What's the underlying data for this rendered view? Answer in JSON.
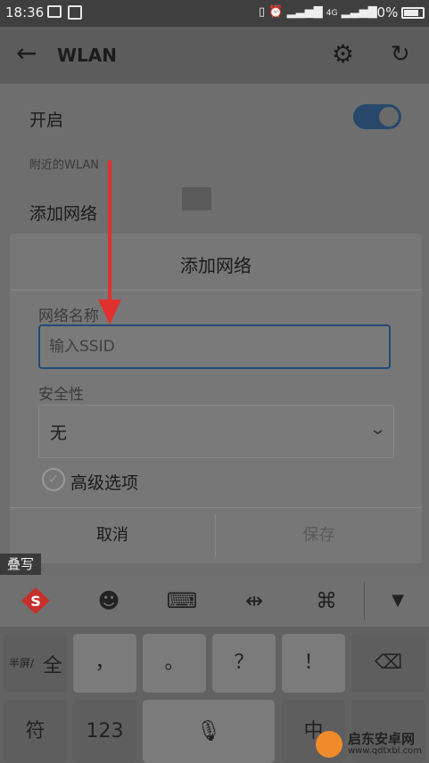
{
  "status_bar": {
    "time": "18:36",
    "network_left": "4G",
    "network_right": "4G\n2G",
    "battery": "80%"
  },
  "app_bar": {
    "title": "WLAN",
    "back_icon": "arrow-left-icon",
    "settings_icon": "gear-icon",
    "refresh_icon": "refresh-icon"
  },
  "settings": {
    "enable_label": "开启",
    "enable_state": true,
    "nearby_header": "附近的WLAN",
    "add_network_label": "添加网络"
  },
  "dialog": {
    "title": "添加网络",
    "ssid_label": "网络名称",
    "ssid_placeholder": "输入SSID",
    "ssid_value": "",
    "security_label": "安全性",
    "security_value": "无",
    "advanced_label": "高级选项",
    "cancel_label": "取消",
    "save_label": "保存"
  },
  "overlay_badge": "叠写",
  "keyboard": {
    "toolbar_icons": [
      "sogou-logo-icon",
      "emoji-icon",
      "keyboard-icon",
      "cursor-icon",
      "command-icon",
      "collapse-icon"
    ],
    "row1": {
      "halfwidth_label": "半屏/",
      "full_label": "全",
      "comma": "，",
      "period": "。",
      "question": "？",
      "exclaim": "！",
      "backspace_icon": "backspace-icon"
    },
    "row2": {
      "symbol_label": "符",
      "numbers_label": "123",
      "space_icon": "mic-icon",
      "lang_label": "中"
    }
  },
  "watermark": {
    "line1": "启东安卓网",
    "line2": "www.qdtxbl.com"
  },
  "colors": {
    "accent": "#224a74",
    "annotation_arrow": "#e0312f"
  }
}
